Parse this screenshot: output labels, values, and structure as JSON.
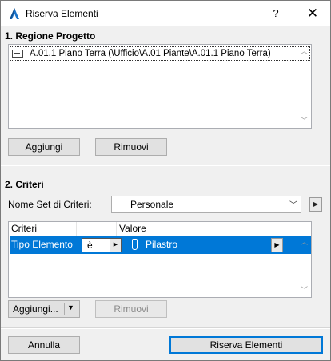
{
  "window": {
    "title": "Riserva Elementi",
    "help_label": "?",
    "close_label": "✕"
  },
  "section1": {
    "title": "1. Regione Progetto",
    "items": [
      {
        "label": "A.01.1 Piano Terra (\\Ufficio\\A.01 Piante\\A.01.1 Piano Terra)",
        "icon": "floor-plan-icon"
      }
    ],
    "add_button": "Aggiungi",
    "remove_button": "Rimuovi"
  },
  "section2": {
    "title": "2. Criteri",
    "set_label": "Nome Set di Criteri:",
    "set_value": "Personale",
    "table": {
      "headers": [
        "Criteri",
        "Valore"
      ],
      "rows": [
        {
          "criterion": "Tipo Elemento",
          "operator": "è",
          "value": "Pilastro",
          "icon": "column-icon"
        }
      ]
    },
    "add_button": "Aggiungi...",
    "remove_button": "Rimuovi"
  },
  "footer": {
    "cancel_button": "Annulla",
    "ok_button": "Riserva Elementi"
  },
  "colors": {
    "selection": "#0078d7",
    "dialog_bg": "#f0f0f0"
  }
}
